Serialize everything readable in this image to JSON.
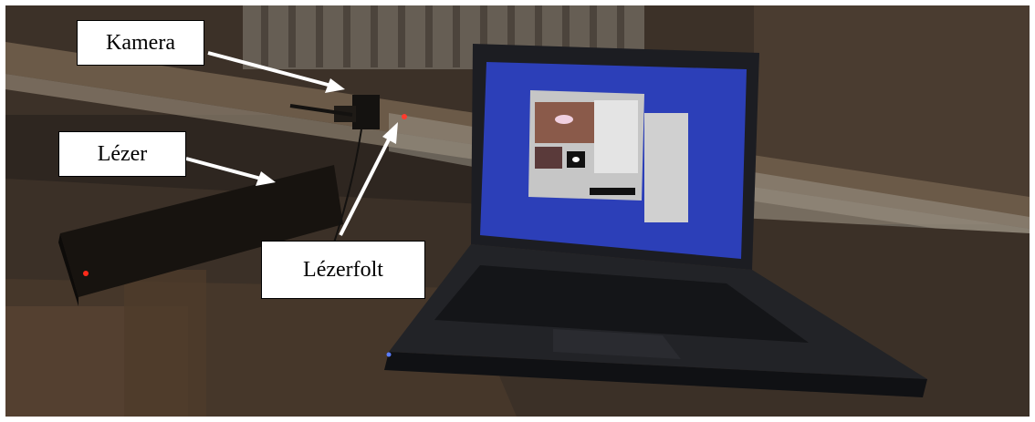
{
  "annotations": {
    "camera": "Kamera",
    "laser": "Lézer",
    "laser_spot": "Lézerfolt"
  },
  "colors": {
    "arrow": "#ffffff",
    "label_bg": "#ffffff",
    "label_border": "#000000",
    "screen": "#2c3fb8",
    "laser_dot": "#ff3b2e"
  }
}
